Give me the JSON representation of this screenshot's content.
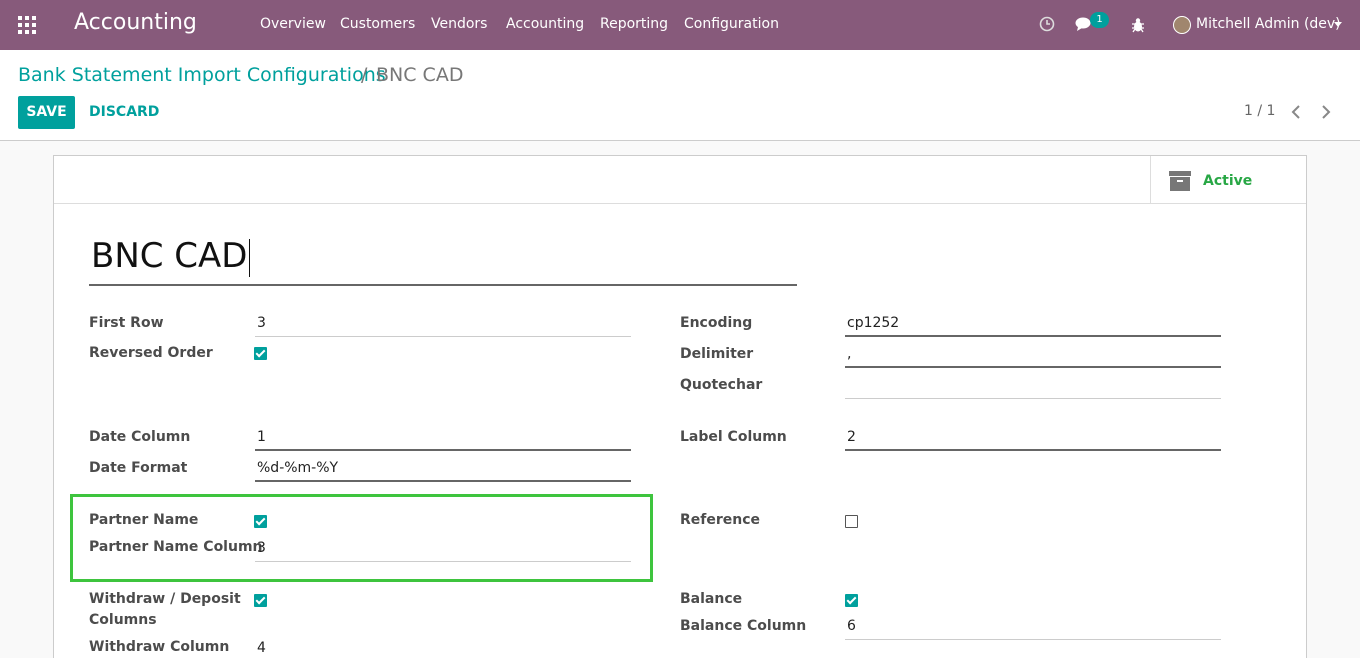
{
  "navbar": {
    "app_title": "Accounting",
    "menu": [
      "Overview",
      "Customers",
      "Vendors",
      "Accounting",
      "Reporting",
      "Configuration"
    ],
    "messages_badge": "1",
    "user_name": "Mitchell Admin (dev)"
  },
  "breadcrumb": {
    "parent": "Bank Statement Import Configurations",
    "separator": "/",
    "current": "BNC CAD"
  },
  "actions": {
    "save": "SAVE",
    "discard": "DISCARD"
  },
  "pager": {
    "value": "1 / 1"
  },
  "smart_button": {
    "label": "Active"
  },
  "record": {
    "name": "BNC CAD"
  },
  "fields": {
    "first_row": {
      "label": "First Row",
      "value": "3"
    },
    "reversed_order": {
      "label": "Reversed Order",
      "checked": true
    },
    "encoding": {
      "label": "Encoding",
      "value": "cp1252"
    },
    "delimiter": {
      "label": "Delimiter",
      "value": ","
    },
    "quotechar": {
      "label": "Quotechar",
      "value": ""
    },
    "date_column": {
      "label": "Date Column",
      "value": "1"
    },
    "date_format": {
      "label": "Date Format",
      "value": "%d-%m-%Y"
    },
    "label_column": {
      "label": "Label Column",
      "value": "2"
    },
    "partner_name": {
      "label": "Partner Name",
      "checked": true
    },
    "partner_name_column": {
      "label": "Partner Name Column",
      "value": "3"
    },
    "reference": {
      "label": "Reference",
      "checked": false
    },
    "withdraw_deposit": {
      "label_line1": "Withdraw / Deposit",
      "label_line2": "Columns",
      "checked": true
    },
    "withdraw_column": {
      "label": "Withdraw Column",
      "value": "4"
    },
    "balance": {
      "label": "Balance",
      "checked": true
    },
    "balance_column": {
      "label": "Balance Column",
      "value": "6"
    }
  },
  "colors": {
    "brand": "#875a7b",
    "accent": "#00a09d",
    "active": "#28a745",
    "highlight": "#3ec43e"
  }
}
